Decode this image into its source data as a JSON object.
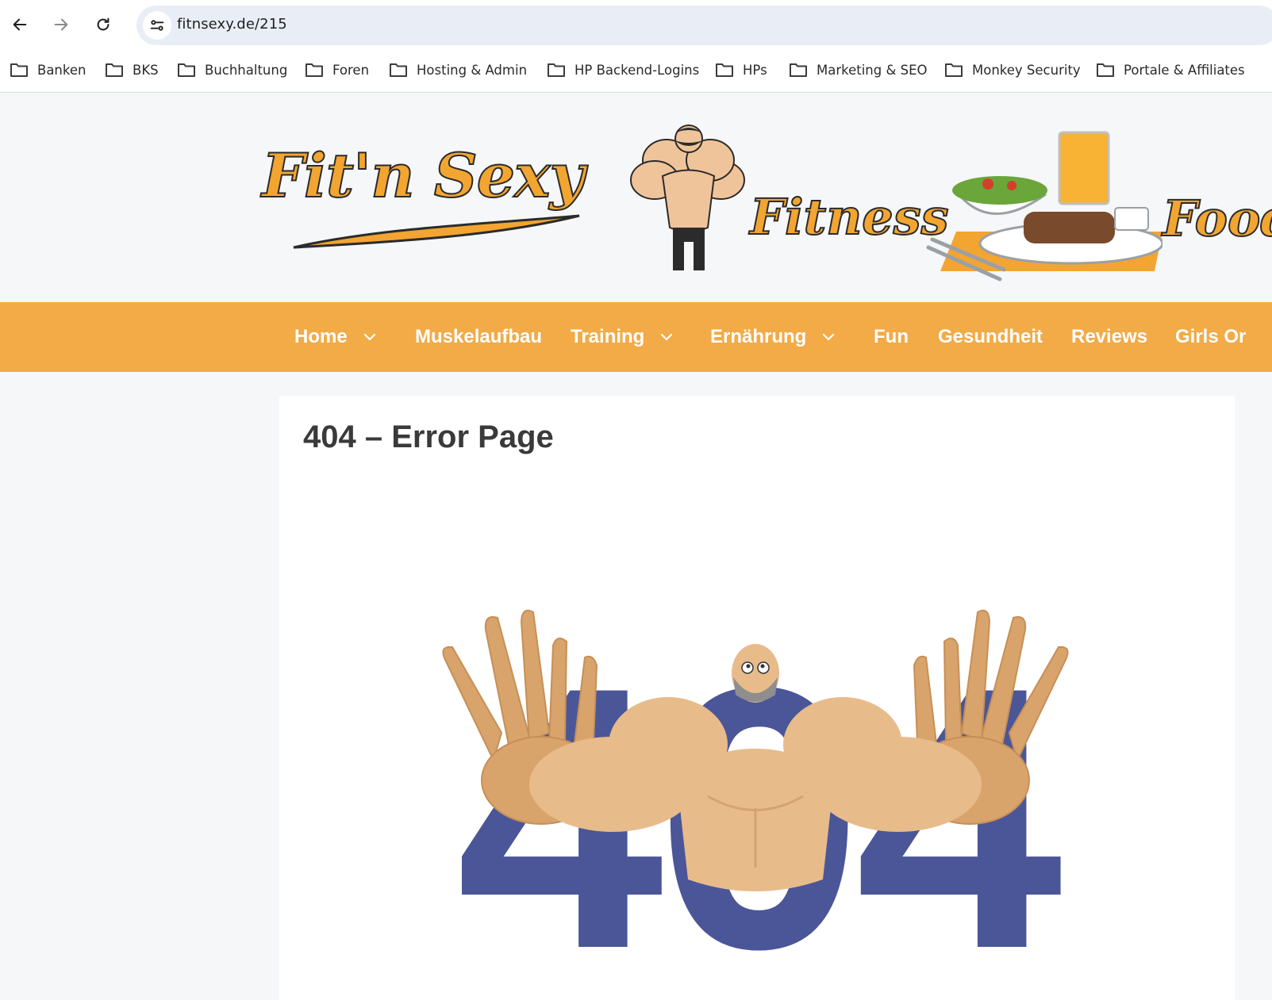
{
  "browser": {
    "url": "fitnsexy.de/215",
    "bookmarks": [
      {
        "label": "Banken"
      },
      {
        "label": "BKS"
      },
      {
        "label": "Buchhaltung"
      },
      {
        "label": "Foren"
      },
      {
        "label": "Hosting & Admin"
      },
      {
        "label": "HP Backend-Logins"
      },
      {
        "label": "HPs"
      },
      {
        "label": "Marketing & SEO"
      },
      {
        "label": "Monkey Security"
      },
      {
        "label": "Portale & Affiliates"
      }
    ]
  },
  "header": {
    "logo_text": "Fit'n Sexy",
    "tagline_fitness": "Fitness",
    "tagline_food": "Food"
  },
  "nav": {
    "items": [
      {
        "label": "Home",
        "has_dropdown": true
      },
      {
        "label": "Muskelaufbau",
        "has_dropdown": false
      },
      {
        "label": "Training",
        "has_dropdown": true
      },
      {
        "label": "Ernährung",
        "has_dropdown": true
      },
      {
        "label": "Fun",
        "has_dropdown": false
      },
      {
        "label": "Gesundheit",
        "has_dropdown": false
      },
      {
        "label": "Reviews",
        "has_dropdown": false
      },
      {
        "label": "Girls Or",
        "has_dropdown": false
      }
    ]
  },
  "main": {
    "title": "404 – Error Page",
    "illustration_text": "404"
  },
  "colors": {
    "nav_bg": "#f2ab46",
    "logo_orange": "#f2a531",
    "error_blue": "#4a5697",
    "skin": "#e8bb8a"
  }
}
